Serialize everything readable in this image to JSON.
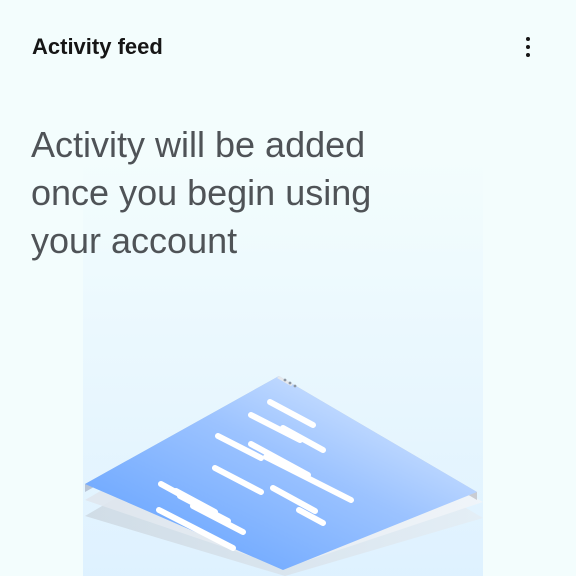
{
  "card": {
    "title": "Activity feed",
    "menu_icon": "overflow-menu-vertical-icon",
    "empty_message": "Activity will be added once you begin using your account",
    "illustration_icon": "document-stack-illustration"
  },
  "colors": {
    "background": "#f3fdfd",
    "title": "#161616",
    "message": "#4f5357",
    "accent_blue": "#5a9bff"
  }
}
